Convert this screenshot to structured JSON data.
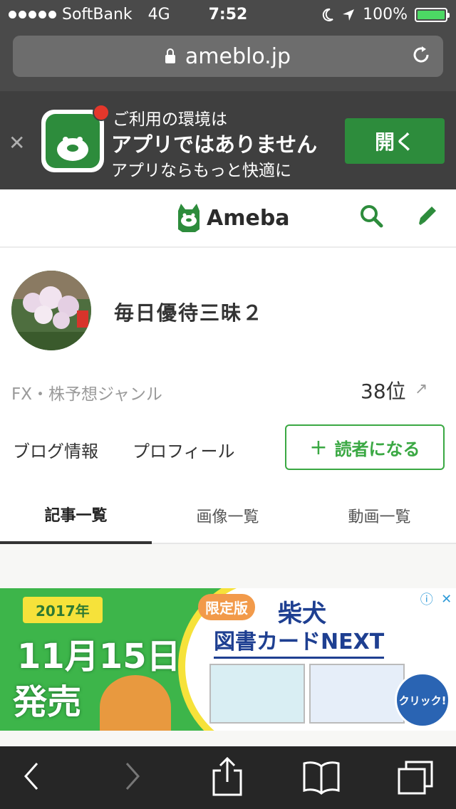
{
  "status_bar": {
    "carrier": "SoftBank",
    "network": "4G",
    "time": "7:52",
    "battery": "100%",
    "battery_level": 1.0,
    "signal_bars": 5
  },
  "browser": {
    "url": "ameblo.jp"
  },
  "app_banner": {
    "line1": "ご利用の環境は",
    "line2": "アプリではありません",
    "line3": "アプリならもっと快適に",
    "open_button": "開く"
  },
  "header": {
    "logo_text": "Ameba"
  },
  "profile": {
    "blog_name": "毎日優待三昧２",
    "genre": "FX・株予想ジャンル",
    "rank": "38位",
    "blog_info": "ブログ情報",
    "profile_link": "プロフィール",
    "follow_button": "読者になる"
  },
  "tabs": [
    {
      "label": "記事一覧",
      "active": true
    },
    {
      "label": "画像一覧",
      "active": false
    },
    {
      "label": "動画一覧",
      "active": false
    }
  ],
  "ad": {
    "year": "2017年",
    "date": "11月15日",
    "release": "発売",
    "limited": "限定版",
    "title1": "柴犬",
    "title2": "図書カードNEXT",
    "click": "クリック!"
  },
  "colors": {
    "accent_green": "#3aa843",
    "banner_button": "#2d8c3c",
    "battery_green": "#4cd964"
  }
}
